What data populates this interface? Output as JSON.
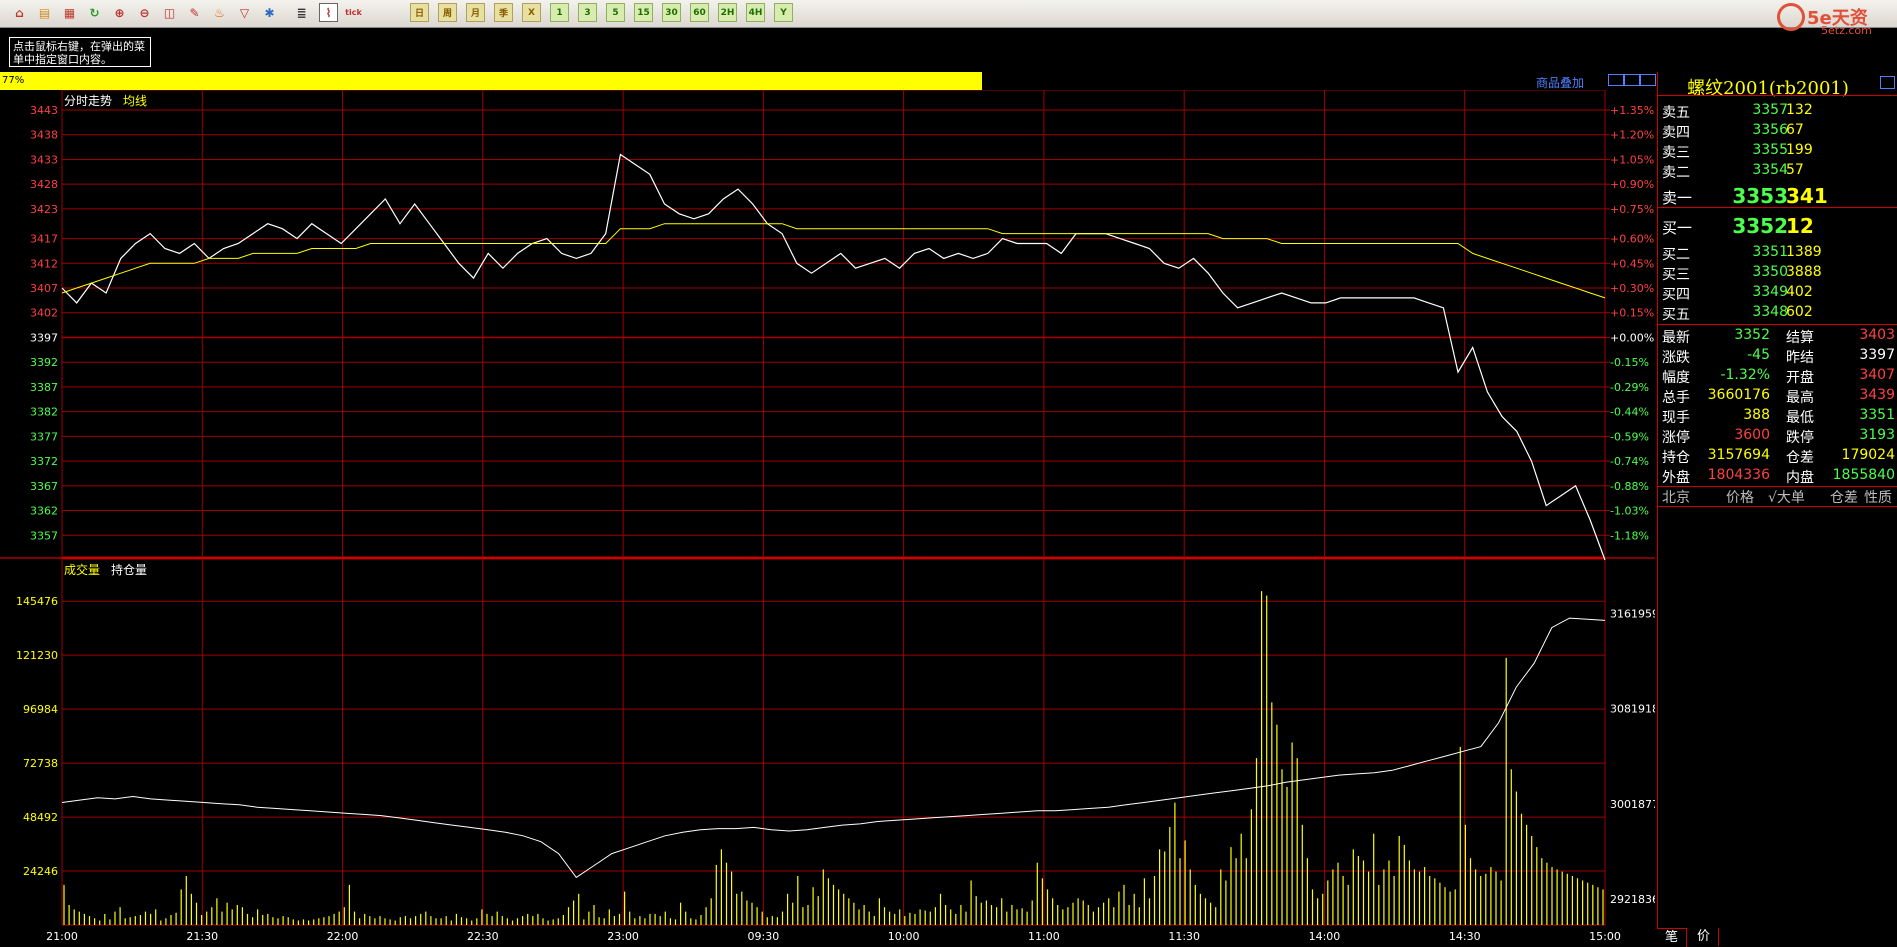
{
  "toolbar": {
    "icons": [
      "home-icon",
      "folder-icon",
      "book-icon",
      "refresh-icon",
      "zoom-in-icon",
      "zoom-out-icon",
      "window-icon",
      "pen-icon",
      "fire-icon",
      "filter-icon",
      "new-icon",
      "list-icon",
      "intraday-chart-icon",
      "tick-icon"
    ],
    "periods": [
      "日",
      "周",
      "月",
      "季",
      "X",
      "1",
      "3",
      "5",
      "15",
      "30",
      "60",
      "2H",
      "4H",
      "Y"
    ],
    "tick_label": "tick"
  },
  "logo": {
    "text": "5e天资",
    "domain": "5etz.com"
  },
  "tip": {
    "text": "点击鼠标右键，在弹出的菜单中指定窗口内容。"
  },
  "progress": {
    "value": 0.77,
    "label": "77%"
  },
  "overlay_link": "商品叠加",
  "chart_data": [
    {
      "type": "line",
      "name": "price",
      "title": "分时走势",
      "legend": [
        "分时走势",
        "均线"
      ],
      "x_ticks": [
        "21:00",
        "21:30",
        "22:00",
        "22:30",
        "23:00",
        "09:30",
        "10:00",
        "11:00",
        "11:30",
        "14:00",
        "14:30",
        "15:00"
      ],
      "y_left_ticks": [
        3443,
        3438,
        3433,
        3428,
        3423,
        3417,
        3412,
        3407,
        3402,
        3397,
        3392,
        3387,
        3382,
        3377,
        3372,
        3367,
        3362,
        3357
      ],
      "y_right_ticks": [
        "+1.35%",
        "+1.20%",
        "+1.05%",
        "+0.90%",
        "+0.75%",
        "+0.60%",
        "+0.45%",
        "+0.30%",
        "+0.15%",
        "+0.00%",
        "-0.15%",
        "-0.29%",
        "-0.44%",
        "-0.59%",
        "-0.74%",
        "-0.88%",
        "-1.03%",
        "-1.18%"
      ],
      "ylim": [
        3352,
        3443
      ],
      "reference": 3397,
      "series": [
        {
          "name": "分时走势",
          "color": "#ffffff",
          "values": [
            3407,
            3404,
            3408,
            3406,
            3413,
            3416,
            3418,
            3415,
            3414,
            3416,
            3413,
            3415,
            3416,
            3418,
            3420,
            3419,
            3417,
            3420,
            3418,
            3416,
            3419,
            3422,
            3425,
            3420,
            3424,
            3420,
            3416,
            3412,
            3409,
            3414,
            3411,
            3414,
            3416,
            3417,
            3414,
            3413,
            3414,
            3418,
            3434,
            3432,
            3430,
            3424,
            3422,
            3421,
            3422,
            3425,
            3427,
            3424,
            3420,
            3418,
            3412,
            3410,
            3412,
            3414,
            3411,
            3412,
            3413,
            3411,
            3414,
            3415,
            3413,
            3414,
            3413,
            3414,
            3417,
            3416,
            3416,
            3416,
            3414,
            3418,
            3418,
            3418,
            3417,
            3416,
            3415,
            3412,
            3411,
            3413,
            3410,
            3406,
            3403,
            3404,
            3405,
            3406,
            3405,
            3404,
            3404,
            3405,
            3405,
            3405,
            3405,
            3405,
            3405,
            3404,
            3403,
            3390,
            3395,
            3386,
            3381,
            3378,
            3372,
            3363,
            3365,
            3367,
            3360,
            3352
          ]
        },
        {
          "name": "均线",
          "color": "#ffff00",
          "values": [
            3406,
            3407,
            3408,
            3409,
            3410,
            3411,
            3412,
            3412,
            3412,
            3412,
            3413,
            3413,
            3413,
            3414,
            3414,
            3414,
            3414,
            3415,
            3415,
            3415,
            3415,
            3416,
            3416,
            3416,
            3416,
            3416,
            3416,
            3416,
            3416,
            3416,
            3416,
            3416,
            3416,
            3416,
            3416,
            3416,
            3416,
            3416,
            3419,
            3419,
            3419,
            3420,
            3420,
            3420,
            3420,
            3420,
            3420,
            3420,
            3420,
            3420,
            3419,
            3419,
            3419,
            3419,
            3419,
            3419,
            3419,
            3419,
            3419,
            3419,
            3419,
            3419,
            3419,
            3419,
            3418,
            3418,
            3418,
            3418,
            3418,
            3418,
            3418,
            3418,
            3418,
            3418,
            3418,
            3418,
            3418,
            3418,
            3418,
            3417,
            3417,
            3417,
            3417,
            3416,
            3416,
            3416,
            3416,
            3416,
            3416,
            3416,
            3416,
            3416,
            3416,
            3416,
            3416,
            3416,
            3414,
            3413,
            3412,
            3411,
            3410,
            3409,
            3408,
            3407,
            3406,
            3405
          ]
        }
      ]
    },
    {
      "type": "bar",
      "name": "volume",
      "legend": [
        "成交量",
        "持仓量"
      ],
      "y_left_ticks": [
        145476,
        121230,
        96984,
        72738,
        48492,
        24246
      ],
      "y_right_ticks": [
        3161959,
        3081918,
        3001877,
        2921836
      ],
      "volume_ylim": [
        0,
        155000
      ],
      "oi_ylim": [
        2900000,
        3190000
      ],
      "volume_values": [
        18000,
        9000,
        7000,
        6000,
        5000,
        4000,
        3000,
        2000,
        5000,
        2500,
        6000,
        8000,
        3000,
        3500,
        4000,
        4500,
        6000,
        5000,
        7000,
        2000,
        3000,
        4500,
        5500,
        16000,
        22000,
        14000,
        10000,
        4500,
        6000,
        8000,
        12000,
        6000,
        10000,
        7000,
        9000,
        8000,
        5000,
        3500,
        7000,
        4500,
        5000,
        3500,
        3000,
        4000,
        3500,
        2500,
        2000,
        2500,
        2000,
        2500,
        3000,
        3500,
        4000,
        5000,
        6000,
        8000,
        18000,
        6000,
        3000,
        5000,
        4000,
        3000,
        4000,
        3000,
        2500,
        2000,
        3500,
        4000,
        3000,
        4000,
        5000,
        6000,
        4000,
        3000,
        3000,
        4000,
        2000,
        5000,
        3500,
        3000,
        2000,
        3000,
        7000,
        5000,
        4000,
        6000,
        4000,
        3000,
        2000,
        3000,
        4000,
        5000,
        4000,
        5000,
        3000,
        2000,
        2500,
        3000,
        4500,
        8000,
        11000,
        14000,
        2500,
        6000,
        9000,
        3500,
        3000,
        7000,
        4000,
        5000,
        15000,
        6000,
        3000,
        4000,
        3000,
        5000,
        5000,
        4000,
        6000,
        3000,
        2500,
        10000,
        6000,
        3000,
        2500,
        4500,
        8000,
        12000,
        27000,
        34000,
        28000,
        24000,
        14000,
        15000,
        11000,
        10000,
        8000,
        6000,
        3500,
        4000,
        3500,
        6000,
        14000,
        10000,
        22000,
        8000,
        9000,
        17000,
        13000,
        25000,
        21000,
        18000,
        16000,
        14000,
        12000,
        10000,
        7000,
        9000,
        6000,
        4000,
        12000,
        8000,
        6000,
        5000,
        7000,
        4000,
        5500,
        5000,
        7000,
        6500,
        6000,
        8000,
        14000,
        9000,
        7000,
        5000,
        9000,
        6000,
        20000,
        13000,
        10000,
        11000,
        9000,
        8000,
        12000,
        6000,
        9000,
        7000,
        7500,
        6000,
        11000,
        28000,
        21000,
        16000,
        12000,
        9000,
        7000,
        8000,
        10000,
        12000,
        11000,
        9000,
        6000,
        8000,
        10000,
        12000,
        8000,
        15000,
        18000,
        9000,
        14000,
        8000,
        21000,
        12000,
        22000,
        34000,
        33000,
        44000,
        55000,
        30000,
        38000,
        25000,
        18000,
        14000,
        12000,
        10000,
        8000,
        25000,
        20000,
        35000,
        30000,
        41000,
        30000,
        52000,
        75000,
        150000,
        148000,
        100000,
        90000,
        70000,
        62000,
        82000,
        75000,
        45000,
        30000,
        16000,
        12000,
        14000,
        20000,
        25000,
        28000,
        22000,
        18000,
        34000,
        31000,
        29000,
        24000,
        41000,
        18000,
        25000,
        29000,
        22000,
        40000,
        36000,
        29000,
        25000,
        24000,
        26000,
        22000,
        21000,
        19000,
        17000,
        15000,
        16000,
        80000,
        45000,
        30000,
        25000,
        22000,
        23000,
        26000,
        24000,
        20000,
        120000,
        70000,
        60000,
        50000,
        45000,
        40000,
        35000,
        30000,
        28000,
        26000,
        25000,
        24000,
        23000,
        22000,
        21000,
        20000,
        19000,
        18000,
        17000,
        16000
      ],
      "oi_values": [
        3003000,
        3005000,
        3007000,
        3006000,
        3008000,
        3006000,
        3005000,
        3004000,
        3003000,
        3002000,
        3001000,
        2999000,
        2998000,
        2997000,
        2996000,
        2995000,
        2994000,
        2993000,
        2992000,
        2990000,
        2988000,
        2986000,
        2984000,
        2982000,
        2980000,
        2978000,
        2975000,
        2970000,
        2960000,
        2940000,
        2950000,
        2960000,
        2965000,
        2970000,
        2975000,
        2978000,
        2980000,
        2981000,
        2981000,
        2982000,
        2980000,
        2979000,
        2980000,
        2982000,
        2984000,
        2985000,
        2987000,
        2988000,
        2989000,
        2990000,
        2991000,
        2992000,
        2993000,
        2994000,
        2995000,
        2996000,
        2996000,
        2997000,
        2998000,
        2999000,
        3001000,
        3003000,
        3005000,
        3007000,
        3009000,
        3011000,
        3013000,
        3015000,
        3017000,
        3020000,
        3022000,
        3024000,
        3026000,
        3027000,
        3028000,
        3030000,
        3034000,
        3038000,
        3042000,
        3046000,
        3050000,
        3070000,
        3100000,
        3120000,
        3150000,
        3158000,
        3157000,
        3156000
      ]
    }
  ],
  "sidebar": {
    "title": "螺纹2001(rb2001)",
    "asks": [
      {
        "label": "卖五",
        "price": "3357",
        "vol": "132"
      },
      {
        "label": "卖四",
        "price": "3356",
        "vol": "67"
      },
      {
        "label": "卖三",
        "price": "3355",
        "vol": "199"
      },
      {
        "label": "卖二",
        "price": "3354",
        "vol": "57"
      },
      {
        "label": "卖一",
        "price": "3353",
        "vol": "341"
      }
    ],
    "bids": [
      {
        "label": "买一",
        "price": "3352",
        "vol": "12"
      },
      {
        "label": "买二",
        "price": "3351",
        "vol": "1389"
      },
      {
        "label": "买三",
        "price": "3350",
        "vol": "3888"
      },
      {
        "label": "买四",
        "price": "3349",
        "vol": "402"
      },
      {
        "label": "买五",
        "price": "3348",
        "vol": "602"
      }
    ],
    "stats": [
      {
        "l1": "最新",
        "v1": "3352",
        "c1": "#4cff4c",
        "l2": "结算",
        "v2": "3403",
        "c2": "#ff4040"
      },
      {
        "l1": "涨跌",
        "v1": "-45",
        "c1": "#4cff4c",
        "l2": "昨结",
        "v2": "3397",
        "c2": "#ffffff"
      },
      {
        "l1": "幅度",
        "v1": "-1.32%",
        "c1": "#4cff4c",
        "l2": "开盘",
        "v2": "3407",
        "c2": "#ff4040"
      },
      {
        "l1": "总手",
        "v1": "3660176",
        "c1": "#ffff00",
        "l2": "最高",
        "v2": "3439",
        "c2": "#ff4040"
      },
      {
        "l1": "现手",
        "v1": "388",
        "c1": "#ffff00",
        "l2": "最低",
        "v2": "3351",
        "c2": "#4cff4c"
      },
      {
        "l1": "涨停",
        "v1": "3600",
        "c1": "#ff4040",
        "l2": "跌停",
        "v2": "3193",
        "c2": "#4cff4c"
      },
      {
        "l1": "持仓",
        "v1": "3157694",
        "c1": "#ffff00",
        "l2": "仓差",
        "v2": "179024",
        "c2": "#ffff00"
      },
      {
        "l1": "外盘",
        "v1": "1804336",
        "c1": "#ff4040",
        "l2": "内盘",
        "v2": "1855840",
        "c2": "#4cff4c"
      }
    ],
    "trade_header": [
      "北京",
      "价格",
      "√大单",
      "仓差",
      "性质"
    ],
    "tabs": [
      "笔",
      "价"
    ]
  },
  "colors": {
    "grid": "#a00000",
    "price_line": "#ffffff",
    "avg_line": "#ffff00",
    "up": "#ff4040",
    "down": "#4cff4c",
    "volume": "#ffff00",
    "oi": "#ffffff"
  }
}
